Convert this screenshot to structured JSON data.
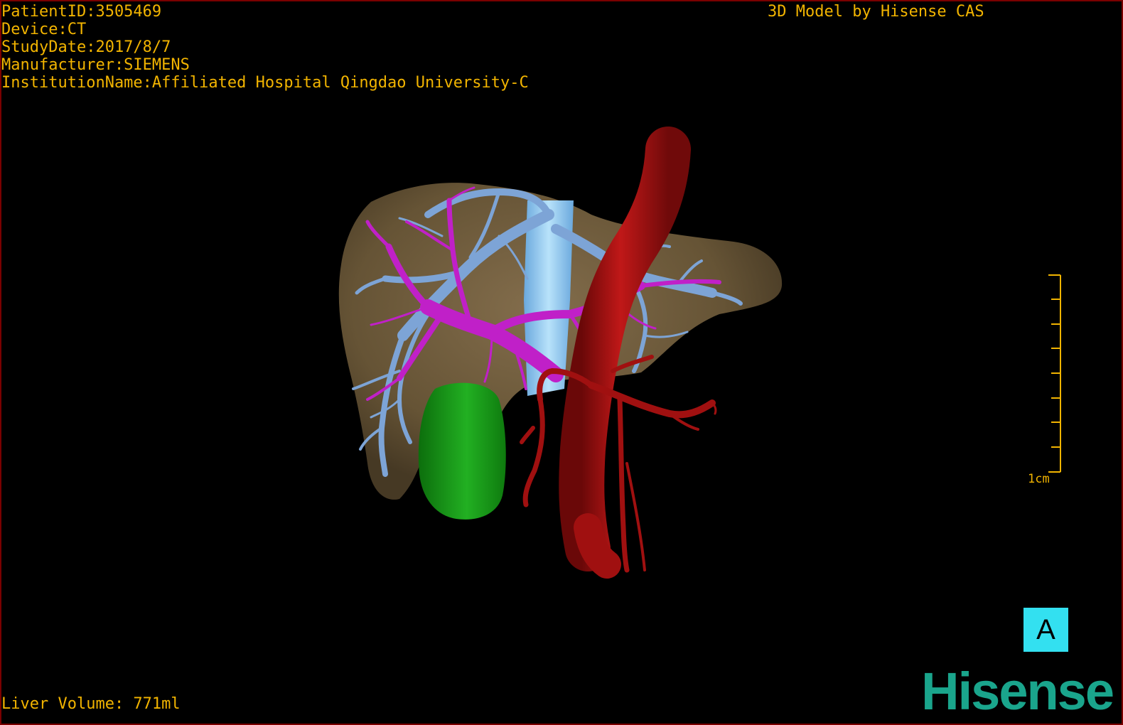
{
  "overlay": {
    "patient_id": "PatientID:3505469",
    "device": "Device:CT",
    "study_date": "StudyDate:2017/8/7",
    "manufacturer": "Manufacturer:SIEMENS",
    "institution": "InstitutionName:Affiliated Hospital Qingdao University-C",
    "brand_text": "3D Model by Hisense CAS",
    "liver_volume": "Liver Volume: 771ml"
  },
  "scale_bar": {
    "label": "1cm"
  },
  "orientation_marker": {
    "label": "A"
  },
  "logo": {
    "text": "Hisense"
  },
  "colors": {
    "overlay_text": "#f2b400",
    "liver": "#6b5838",
    "hepatic_vein": "#7da4d6",
    "portal_vein": "#c020c8",
    "artery": "#a01010",
    "gallbladder": "#1a9a1a",
    "ivc": "#8ec8ef",
    "orientation_box": "#33e0f0",
    "logo": "#1aa58c",
    "frame_border": "#7a0000"
  }
}
